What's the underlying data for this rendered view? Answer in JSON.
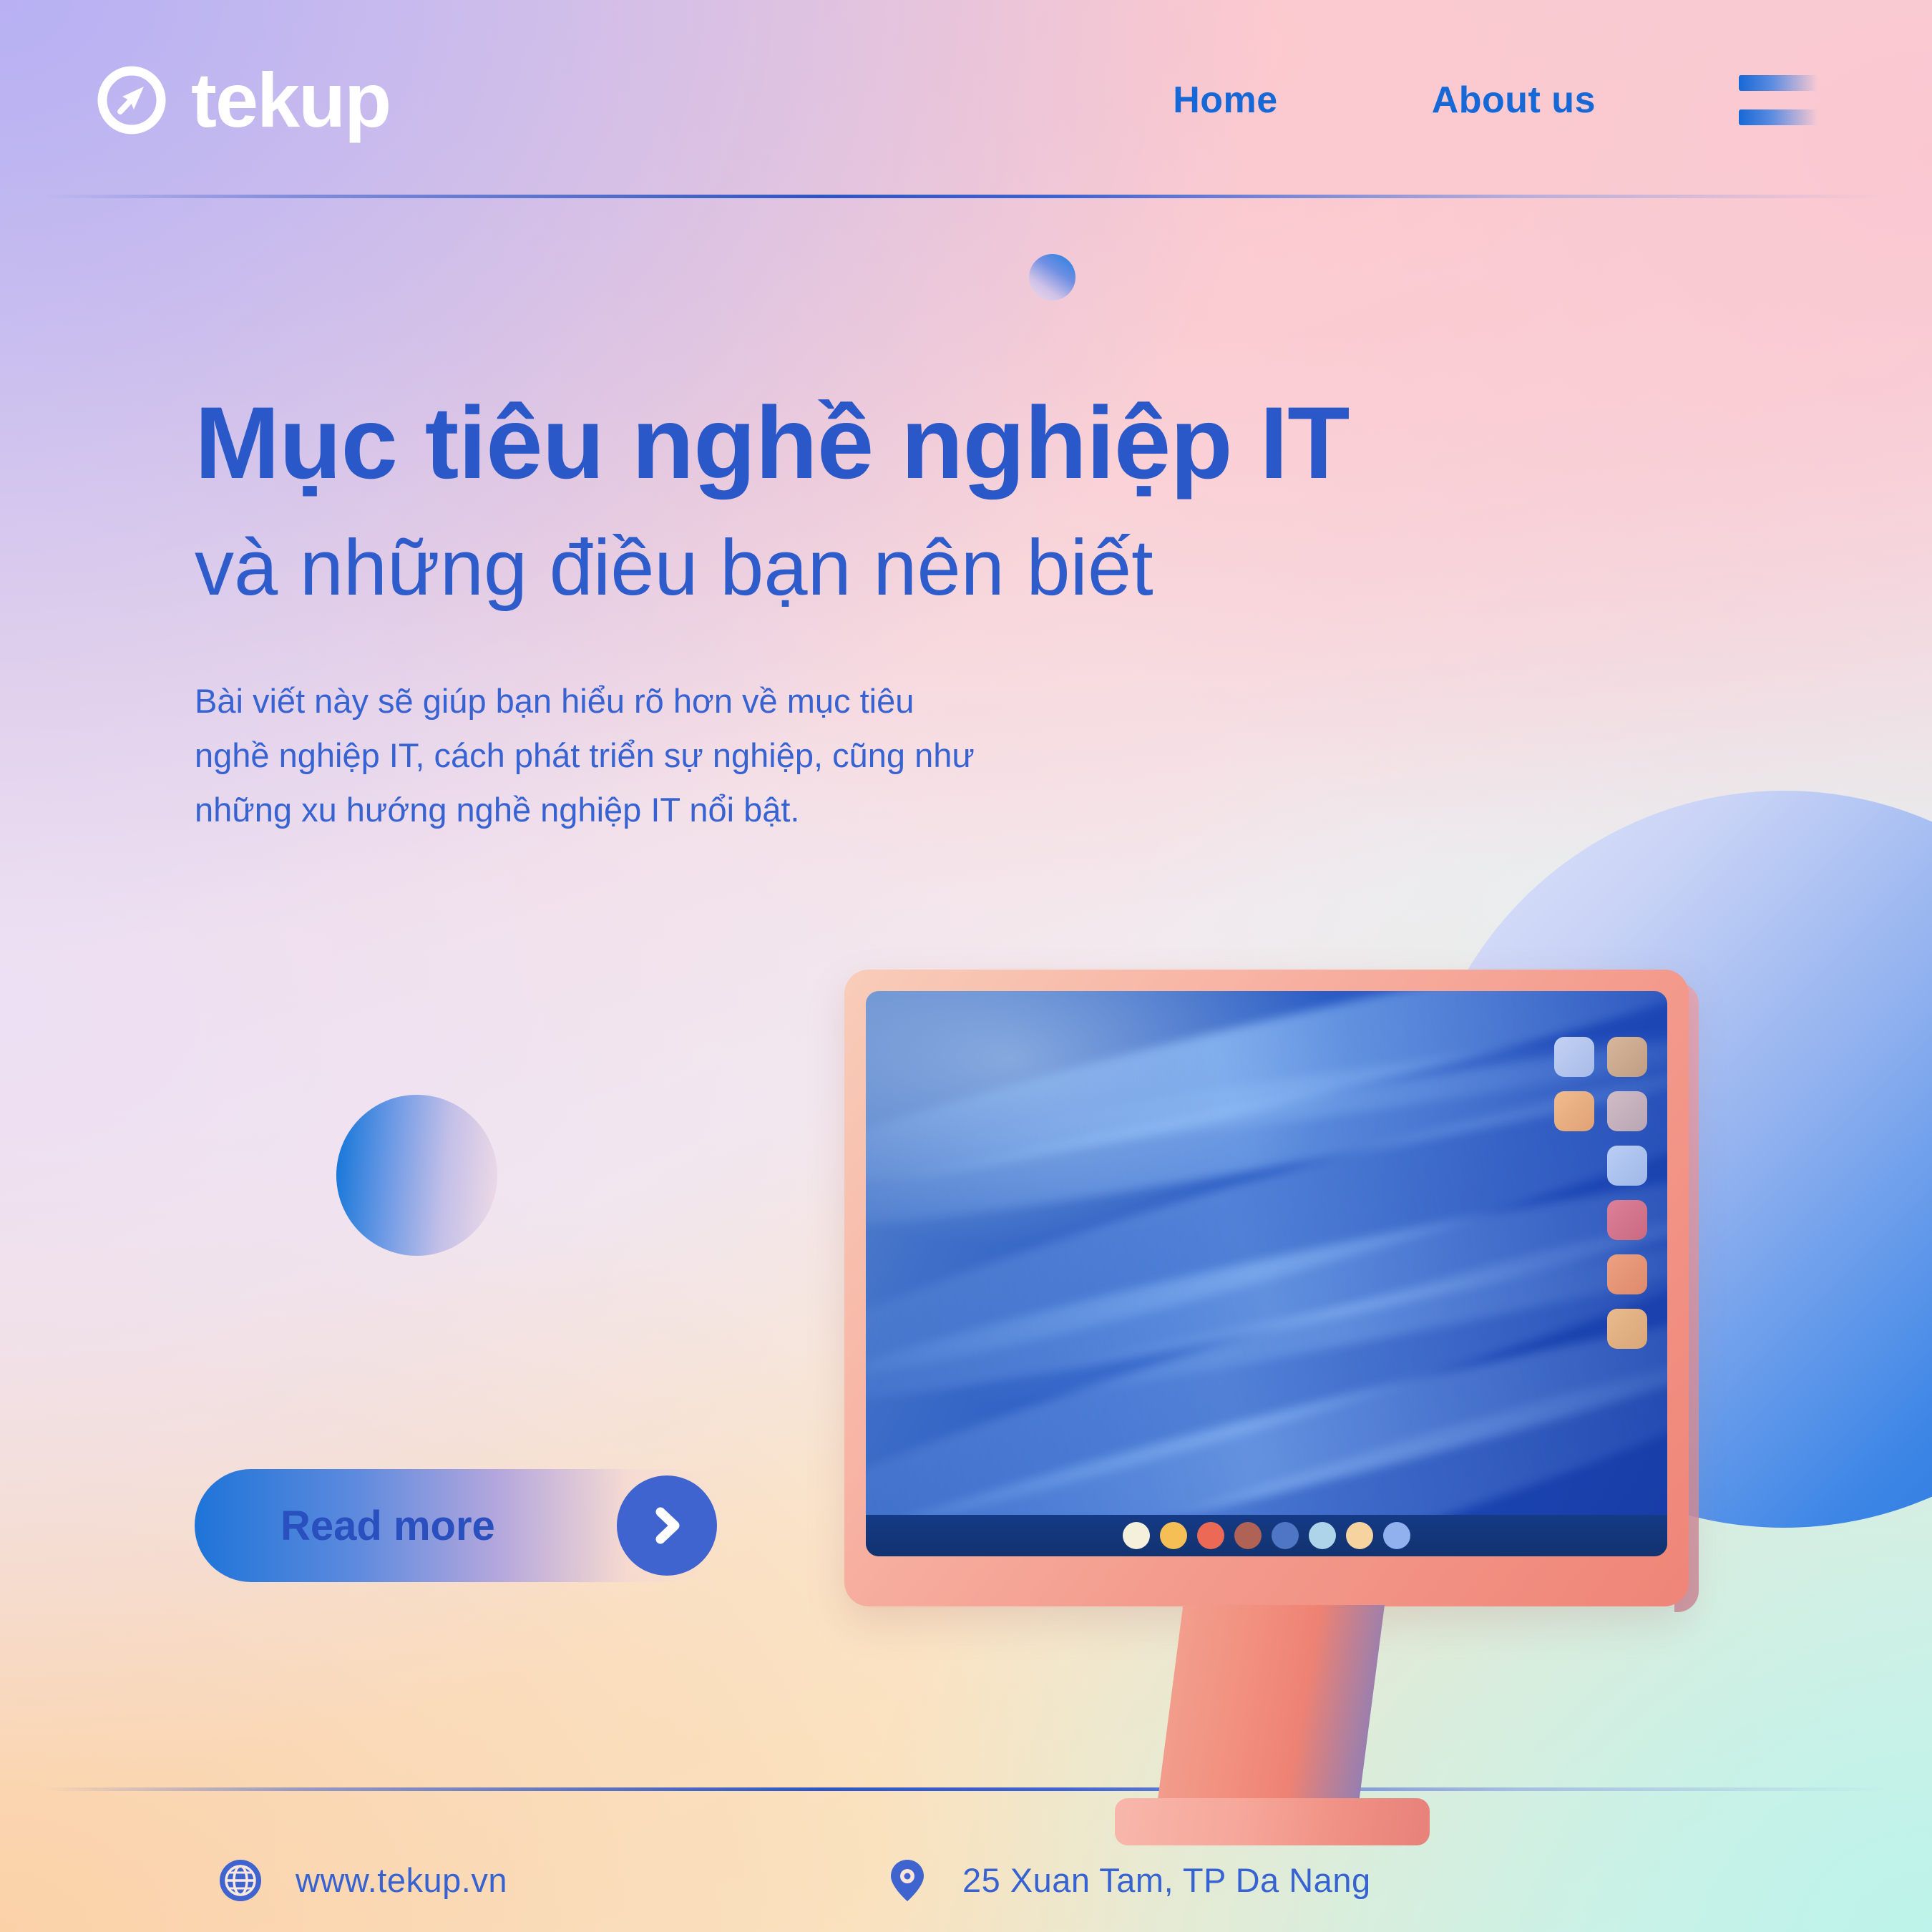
{
  "brand": {
    "name": "tekup",
    "logo_icon": "send-arrow-circle-icon",
    "logo_color": "#ffffff"
  },
  "colors": {
    "accent_blue": "#2a58c8",
    "nav_blue": "#1668d6",
    "body_blue": "#3763d2",
    "arrow_circle": "#3f63cf",
    "monitor_coral": "#f0907f"
  },
  "header": {
    "nav": [
      {
        "label": "Home",
        "name": "nav-home"
      },
      {
        "label": "About us",
        "name": "nav-about"
      }
    ],
    "menu_icon": "hamburger-menu-icon"
  },
  "hero": {
    "headline_line1": "Mục tiêu nghề nghiệp IT",
    "headline_line2": "và những điều bạn nên biết",
    "subtext": "Bài viết này sẽ giúp bạn hiểu rõ hơn về mục tiêu\nnghề nghiệp IT, cách phát triển sự nghiệp, cũng như\nnhững xu hướng nghề nghiệp IT nổi bật."
  },
  "cta": {
    "label": "Read more",
    "arrow_icon": "chevron-right-icon"
  },
  "illustration": {
    "device": "desktop-monitor",
    "wallpaper": "blue-wave-abstract",
    "app_icons": [
      {
        "color": "#b4c6ef",
        "name": "app-icon-1"
      },
      {
        "color": "#c9a98f",
        "name": "app-icon-2"
      },
      {
        "color": "#e8b184",
        "name": "app-icon-3"
      },
      {
        "color": "#c4b0bd",
        "name": "app-icon-4"
      },
      {
        "color": "#aec5ee",
        "name": "app-icon-5"
      },
      {
        "color": "#d4758c",
        "name": "app-icon-6"
      },
      {
        "color": "#e29574",
        "name": "app-icon-7"
      },
      {
        "color": "#e0b184",
        "name": "app-icon-8"
      }
    ],
    "dock_dots": [
      {
        "color": "#f5f0dc",
        "name": "dock-dot-1"
      },
      {
        "color": "#f6bf56",
        "name": "dock-dot-2"
      },
      {
        "color": "#ec6a55",
        "name": "dock-dot-3"
      },
      {
        "color": "#b06254",
        "name": "dock-dot-4"
      },
      {
        "color": "#4f76c4",
        "name": "dock-dot-5"
      },
      {
        "color": "#add4e8",
        "name": "dock-dot-6"
      },
      {
        "color": "#f7d3a0",
        "name": "dock-dot-7"
      },
      {
        "color": "#90b0ee",
        "name": "dock-dot-8"
      }
    ],
    "decor_spheres": [
      "small-sphere",
      "medium-sphere",
      "large-sphere"
    ]
  },
  "footer": {
    "website": "www.tekup.vn",
    "website_icon": "globe-icon",
    "address": "25 Xuan Tam, TP Da Nang",
    "address_icon": "location-pin-icon"
  }
}
